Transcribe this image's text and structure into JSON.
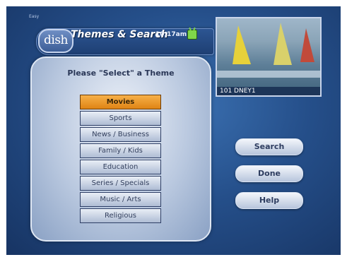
{
  "screen": {
    "corner_tag": "Easy"
  },
  "header": {
    "logo_text": "dish",
    "title": "Themes & Search",
    "time": "10:17am"
  },
  "preview": {
    "channel_label": "101 DNEY1"
  },
  "panel": {
    "prompt": "Please \"Select\" a Theme",
    "themes": [
      {
        "label": "Movies",
        "selected": true
      },
      {
        "label": "Sports",
        "selected": false
      },
      {
        "label": "News / Business",
        "selected": false
      },
      {
        "label": "Family / Kids",
        "selected": false
      },
      {
        "label": "Education",
        "selected": false
      },
      {
        "label": "Series / Specials",
        "selected": false
      },
      {
        "label": "Music / Arts",
        "selected": false
      },
      {
        "label": "Religious",
        "selected": false
      }
    ]
  },
  "buttons": {
    "search": "Search",
    "done": "Done",
    "help": "Help"
  },
  "colors": {
    "background": "#254f8a",
    "selected_item": "#df8415",
    "status_icon": "#7fd64a"
  }
}
